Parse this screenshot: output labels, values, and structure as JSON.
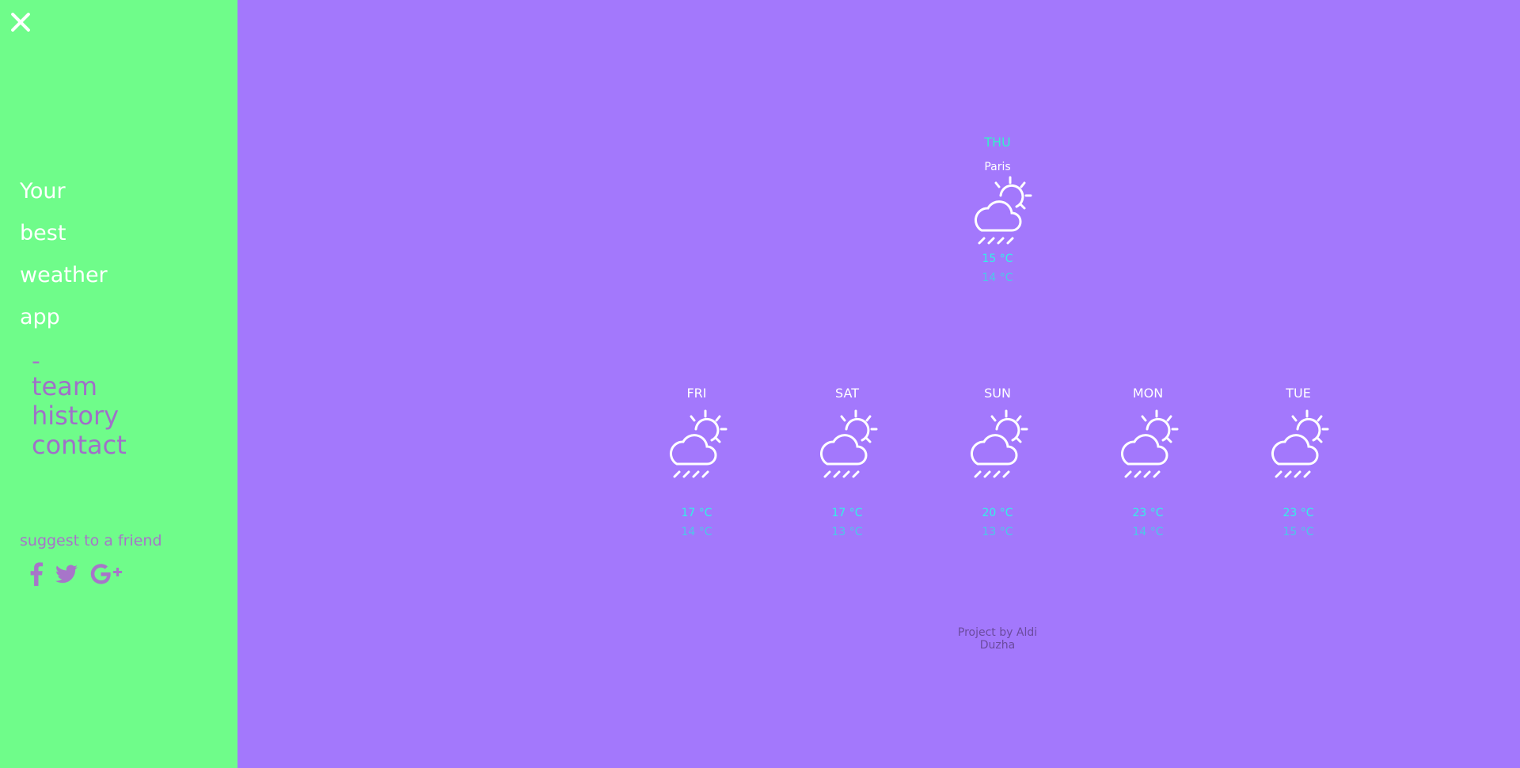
{
  "sidebar": {
    "tagline": [
      "Your",
      "best",
      "weather",
      "app"
    ],
    "menu_dash": "-",
    "menu": [
      "team",
      "history",
      "contact"
    ],
    "suggest": "suggest to a friend",
    "social_icons": [
      "facebook-icon",
      "twitter-icon",
      "google-plus-icon"
    ]
  },
  "today": {
    "day": "THU",
    "city": "Paris",
    "high": "15 °C",
    "low": "14 °C"
  },
  "forecast": [
    {
      "day": "FRI",
      "high": "17 °C",
      "low": "14 °C"
    },
    {
      "day": "SAT",
      "high": "17 °C",
      "low": "13 °C"
    },
    {
      "day": "SUN",
      "high": "20 °C",
      "low": "13 °C"
    },
    {
      "day": "MON",
      "high": "23 °C",
      "low": "14 °C"
    },
    {
      "day": "TUE",
      "high": "23 °C",
      "low": "15 °C"
    }
  ],
  "footer": "Project by Aldi Duzha",
  "colors": {
    "sidebar_bg": "#6ffc8a",
    "main_bg": "#a378fc",
    "accent_cyan": "#31f3e6",
    "menu_purple": "#a070c8"
  }
}
